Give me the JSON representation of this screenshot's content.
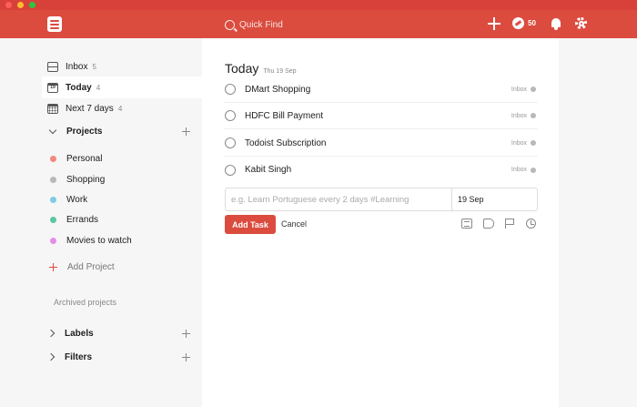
{
  "topbar": {
    "search_placeholder": "Quick Find",
    "karma": "50",
    "accent": "#db4c3f"
  },
  "sidebar": {
    "filters": [
      {
        "label": "Inbox",
        "count": "5",
        "icon": "inbox-icon"
      },
      {
        "label": "Today",
        "count": "4",
        "icon": "calendar-today-icon"
      },
      {
        "label": "Next 7 days",
        "count": "4",
        "icon": "calendar-week-icon"
      }
    ],
    "today_icon_number": "19",
    "projects_header": "Projects",
    "projects": [
      {
        "label": "Personal",
        "color": "#f08a7e"
      },
      {
        "label": "Shopping",
        "color": "#b8b8b8"
      },
      {
        "label": "Work",
        "color": "#7ecbe7"
      },
      {
        "label": "Errands",
        "color": "#5bc7a2"
      },
      {
        "label": "Movies to watch",
        "color": "#e48ee8"
      }
    ],
    "add_project": "Add Project",
    "archived": "Archived projects",
    "labels_header": "Labels",
    "filters_header": "Filters"
  },
  "main": {
    "title": "Today",
    "date": "Thu 19 Sep",
    "tasks": [
      {
        "name": "DMart Shopping",
        "project": "Inbox"
      },
      {
        "name": "HDFC Bill Payment",
        "project": "Inbox"
      },
      {
        "name": "Todoist Subscription",
        "project": "Inbox"
      },
      {
        "name": "Kabit Singh",
        "project": "Inbox"
      }
    ],
    "editor": {
      "placeholder": "e.g. Learn Portuguese every 2 days #Learning",
      "value": "",
      "date": "19 Sep"
    },
    "add_task": "Add Task",
    "cancel": "Cancel"
  }
}
